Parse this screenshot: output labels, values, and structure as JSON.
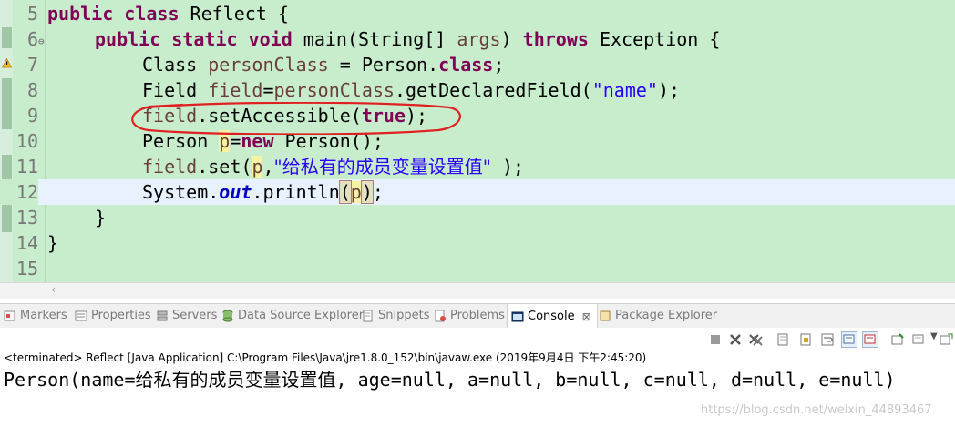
{
  "editor": {
    "lines": [
      {
        "num": "5"
      },
      {
        "num": "6"
      },
      {
        "num": "7"
      },
      {
        "num": "8"
      },
      {
        "num": "9"
      },
      {
        "num": "10"
      },
      {
        "num": "11"
      },
      {
        "num": "12"
      },
      {
        "num": "13"
      },
      {
        "num": "14"
      },
      {
        "num": "15"
      }
    ],
    "tokens": {
      "public": "public",
      "class": "class",
      "reflect": " Reflect {",
      "static": "static",
      "void": "void",
      "main_sig": " main(String[] ",
      "args": "args",
      "close_paren": ") ",
      "throws": "throws",
      "exception": " Exception {",
      "class_kw_type": "Class ",
      "personClass": "personClass",
      "assign_person": " = Person.",
      "semi": ";",
      "field_type": "Field ",
      "field": "field",
      "eq": "=",
      "getDeclaredField": ".getDeclaredField(",
      "str_name": "\"name\"",
      "close_semi": ");",
      "setAccessible": ".setAccessible(",
      "true": "true",
      "person_type": "Person ",
      "p": "p",
      "new": "new",
      "person_ctor": " Person();",
      "set_open": ".set(",
      "comma": ",",
      "str_value": "\"给私有的成员变量设置值\"",
      "space_close": " );",
      "system": "System.",
      "out": "out",
      "println": ".println",
      "lparen": "(",
      "rparen": ")",
      "rbrace": "}"
    }
  },
  "tabs": [
    {
      "label": "Markers",
      "icon": "markers-icon"
    },
    {
      "label": "Properties",
      "icon": "properties-icon"
    },
    {
      "label": "Servers",
      "icon": "servers-icon"
    },
    {
      "label": "Data Source Explorer",
      "icon": "data-source-icon"
    },
    {
      "label": "Snippets",
      "icon": "snippets-icon"
    },
    {
      "label": "Problems",
      "icon": "problems-icon"
    },
    {
      "label": "Console",
      "icon": "console-icon",
      "active": true,
      "close": "⊠"
    },
    {
      "label": "Package Explorer",
      "icon": "package-explorer-icon"
    }
  ],
  "console": {
    "header": "<terminated> Reflect [Java Application] C:\\Program Files\\Java\\jre1.8.0_152\\bin\\javaw.exe (2019年9月4日 下午2:45:20)",
    "output": "Person(name=给私有的成员变量设置值, age=null, a=null, b=null, c=null, d=null, e=null)"
  },
  "watermark": "https://blog.csdn.net/weixin_44893467",
  "colors": {
    "editor_bg": "#c7edcc",
    "keyword": "#7f0055",
    "string": "#2a00ff",
    "local_var": "#6a3e3e",
    "static_field": "#0000c0",
    "annotation_circle": "#e02020"
  }
}
